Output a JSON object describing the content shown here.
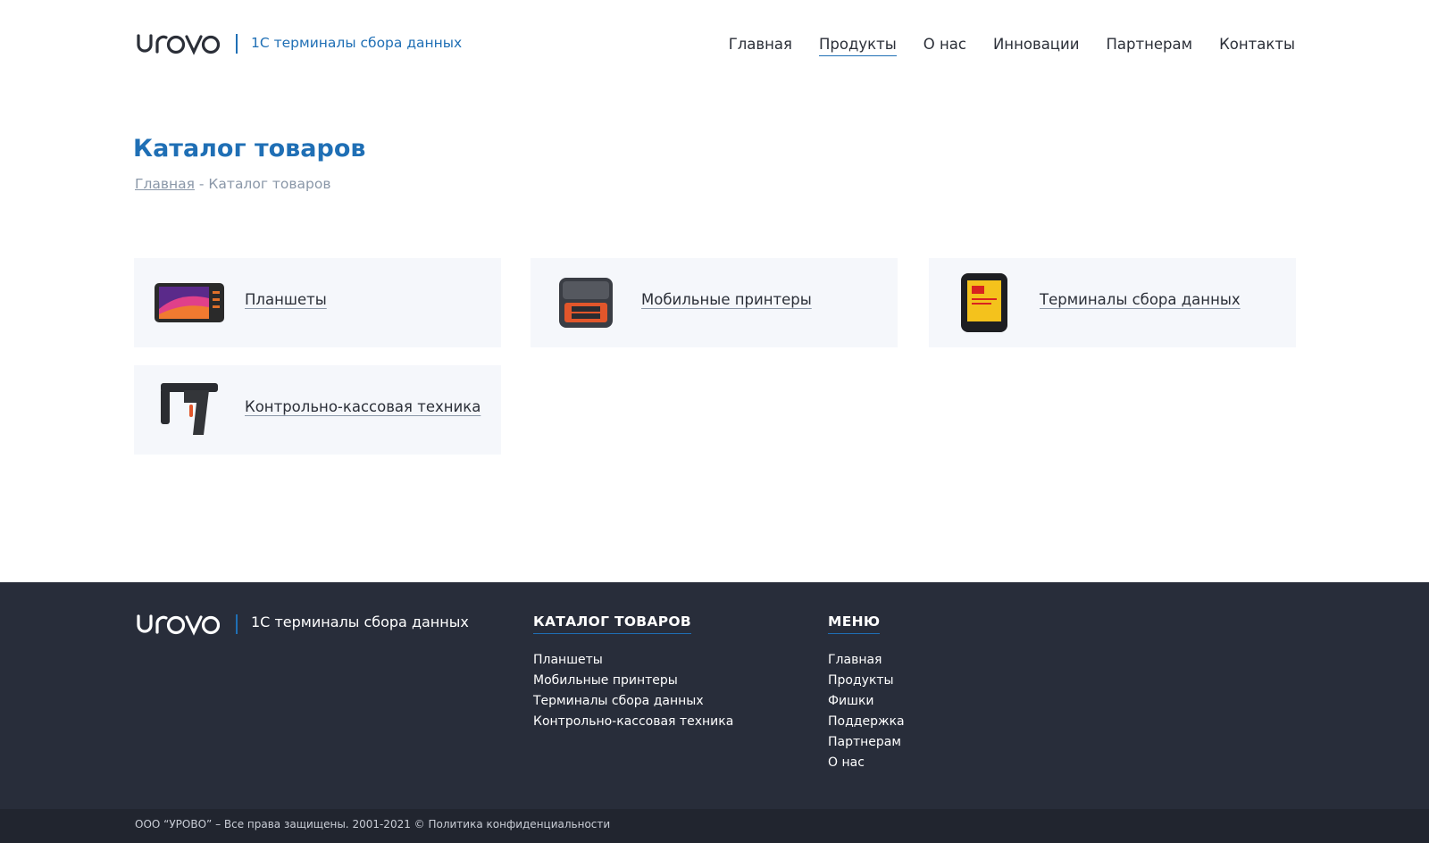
{
  "header": {
    "logo_text": "urovo",
    "tagline": "1С терминалы сбора данных",
    "nav": [
      {
        "label": "Главная"
      },
      {
        "label": "Продукты"
      },
      {
        "label": "О нас"
      },
      {
        "label": "Инновации"
      },
      {
        "label": "Партнерам"
      },
      {
        "label": "Контакты"
      }
    ],
    "active_nav": "Продукты"
  },
  "page": {
    "title": "Каталог товаров",
    "breadcrumb": {
      "home": "Главная",
      "separator": " - ",
      "current": "Каталог товаров"
    }
  },
  "catalog": [
    {
      "label": "Планшеты",
      "icon": "tablet-icon"
    },
    {
      "label": "Мобильные принтеры",
      "icon": "mobile-printer-icon"
    },
    {
      "label": "Терминалы сбора данных",
      "icon": "data-terminal-icon"
    },
    {
      "label": "Контрольно-кассовая техника",
      "icon": "scanner-gun-icon"
    }
  ],
  "footer": {
    "logo_text": "urovo",
    "tagline": "1С терминалы сбора данных",
    "catalog_heading": "КАТАЛОГ ТОВАРОВ",
    "catalog_links": [
      "Планшеты",
      "Мобильные принтеры",
      "Терминалы сбора данных",
      "Контрольно-кассовая техника"
    ],
    "menu_heading": "МЕНЮ",
    "menu_links": [
      "Главная",
      "Продукты",
      "Фишки",
      "Поддержка",
      "Партнерам",
      "О нас"
    ],
    "copyright": "ООО “УРОВО” – Все права защищены.  2001-2021 © Политика конфиденциальности"
  },
  "colors": {
    "accent": "#1f6fb5",
    "card_bg": "#f5f7fb",
    "footer_bg": "#282d3a",
    "bottom_bg": "#21252f"
  }
}
